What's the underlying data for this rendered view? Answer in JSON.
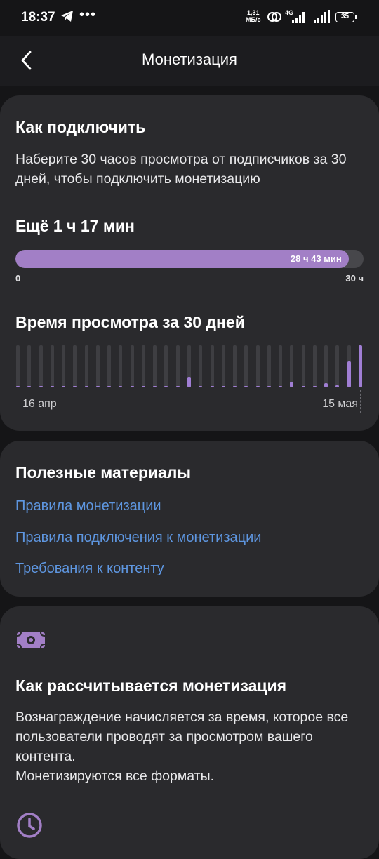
{
  "status_bar": {
    "time": "18:37",
    "net_speed_value": "1,31",
    "net_speed_unit": "МБ/с",
    "network": "4G",
    "battery": "35"
  },
  "header": {
    "title": "Монетизация"
  },
  "how_to_connect": {
    "title": "Как подключить",
    "description": "Наберите 30 часов просмотра от подписчиков за 30 дней, чтобы подключить монетизацию",
    "remaining": "Ещё 1 ч 17 мин",
    "progress_label": "28 ч 43 мин",
    "progress_fraction": 0.957,
    "progress_min_label": "0",
    "progress_max_label": "30 ч",
    "watch_time_title": "Время просмотра за 30 дней",
    "chart_data": {
      "type": "bar",
      "x_start_label": "16 апр",
      "x_end_label": "15 мая",
      "values": [
        0.02,
        0.02,
        0.02,
        0.02,
        0.02,
        0.02,
        0.02,
        0.02,
        0.02,
        0.02,
        0.02,
        0.02,
        0.02,
        0.02,
        0.03,
        0.25,
        0.02,
        0.02,
        0.02,
        0.03,
        0.02,
        0.02,
        0.02,
        0.02,
        0.14,
        0.04,
        0.04,
        0.1,
        0.05,
        0.62,
        1.0
      ],
      "ylim": [
        0,
        1
      ]
    }
  },
  "useful": {
    "title": "Полезные материалы",
    "links": [
      "Правила монетизации",
      "Правила подключения к монетизации",
      "Требования к контенту"
    ]
  },
  "calculation": {
    "icon": "money-icon",
    "title": "Как рассчитывается монетизация",
    "text_line1": "Вознаграждение начисляется за время, которое все пользователи проводят за просмотром вашего контента.",
    "text_line2": "Монетизируются все форматы."
  },
  "colors": {
    "accent": "#a27fc6",
    "link": "#5e96e0",
    "card": "#2a2a2d",
    "background": "#151517"
  }
}
